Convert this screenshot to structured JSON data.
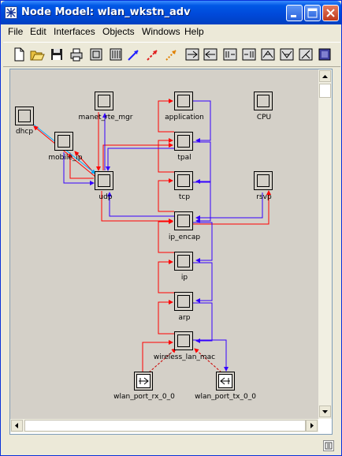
{
  "window": {
    "title": "Node Model: wlan_wkstn_adv"
  },
  "titlebar_buttons": {
    "minimize": "minimize-icon",
    "maximize": "maximize-icon",
    "close": "close-icon"
  },
  "menu": [
    "File",
    "Edit",
    "Interfaces",
    "Objects",
    "Windows",
    "Help"
  ],
  "toolbar_tools": [
    "new-icon",
    "open-icon",
    "save-icon",
    "print-icon",
    "processor-icon",
    "queue-icon",
    "packet-stream-icon",
    "statwire-icon",
    "association-icon",
    "point-to-point-rx-icon",
    "point-to-point-tx-icon",
    "bus-rx-icon",
    "bus-tx-icon",
    "radio-rx-icon",
    "radio-tx-icon",
    "antenna-icon",
    "external-system-icon"
  ],
  "nodes": {
    "dhcp": "dhcp",
    "manet_rte_mgr": "manet_rte_mgr",
    "application": "application",
    "cpu": "CPU",
    "mobile_ip": "mobile_ip",
    "tpal": "tpal",
    "udp": "udp",
    "tcp": "tcp",
    "rsvp": "rsvp",
    "ip_encap": "ip_encap",
    "ip": "ip",
    "arp": "arp",
    "wireless_lan_mac": "wireless_lan_mac",
    "wlan_port_rx": "wlan_port_rx_0_0",
    "wlan_port_tx": "wlan_port_tx_0_0"
  },
  "colors": {
    "stream_down": "#ff0000",
    "stream_up": "#3300ff",
    "stat_wire": "#00aaff",
    "titlebar": "#0048d8"
  }
}
